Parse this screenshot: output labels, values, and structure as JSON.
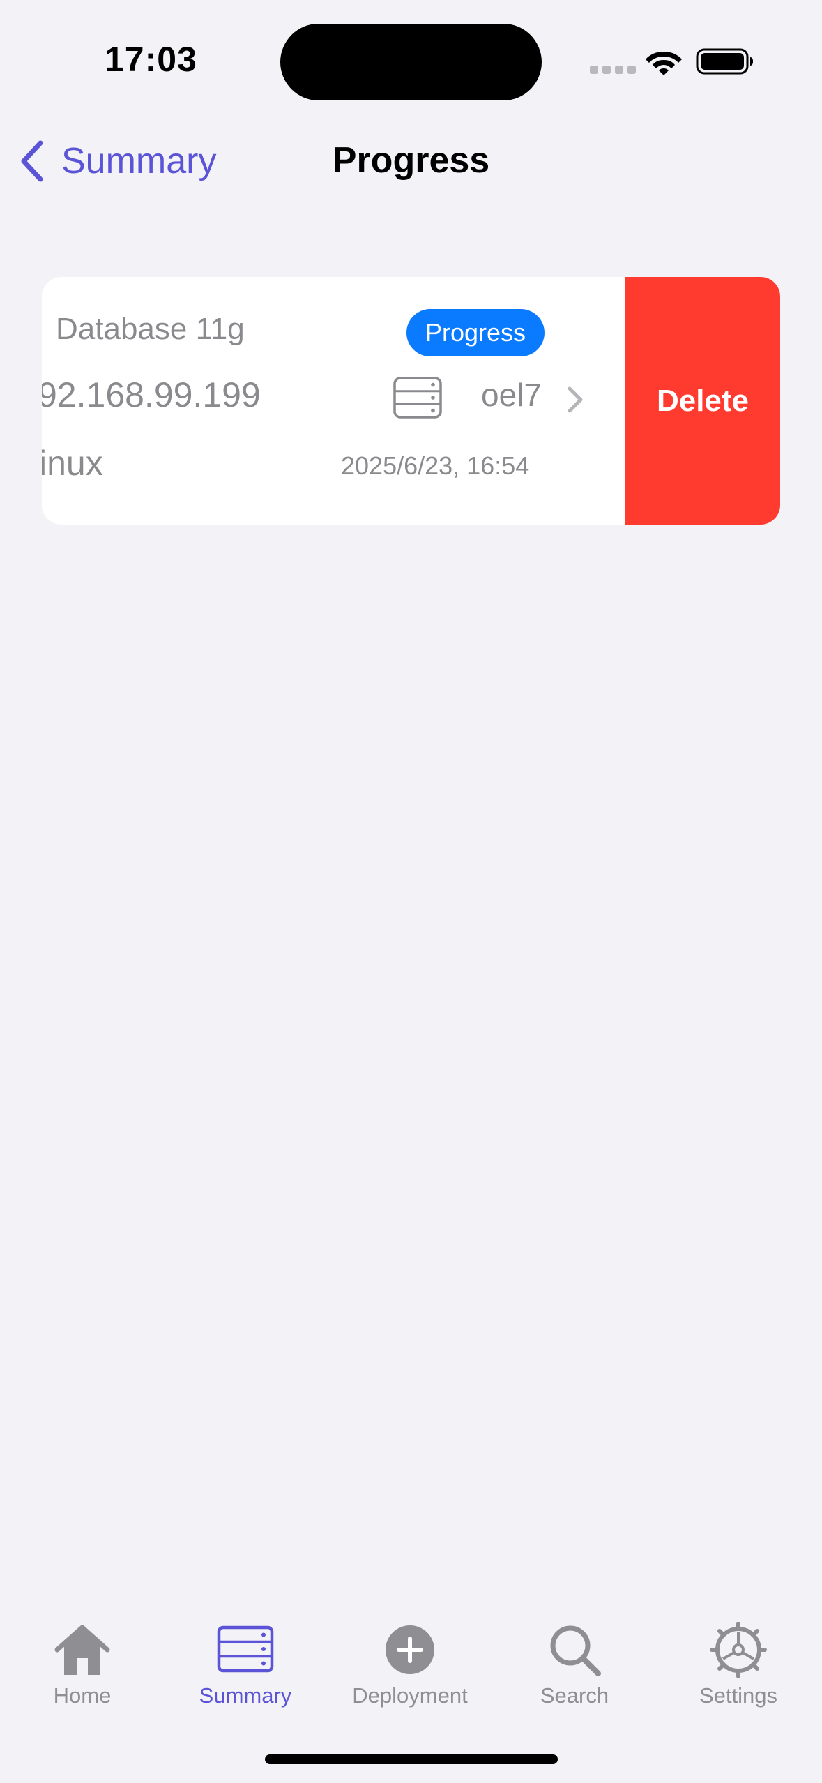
{
  "status_bar": {
    "time": "17:03"
  },
  "nav": {
    "back_label": "Summary",
    "title": "Progress"
  },
  "card": {
    "name": "Database 11g",
    "status": "Progress",
    "ip": "92.168.99.199",
    "host": "oel7",
    "os": "inux",
    "timestamp": "2025/6/23, 16:54",
    "delete_label": "Delete"
  },
  "tabs": [
    {
      "label": "Home",
      "icon": "house-icon"
    },
    {
      "label": "Summary",
      "icon": "server-rack-icon"
    },
    {
      "label": "Deployment",
      "icon": "plus-circle-icon"
    },
    {
      "label": "Search",
      "icon": "magnifier-icon"
    },
    {
      "label": "Settings",
      "icon": "gear-icon"
    }
  ],
  "colors": {
    "accent": "#5b54d6",
    "badge": "#0a7aff",
    "delete": "#ff3b30",
    "background": "#f2f2f7"
  }
}
